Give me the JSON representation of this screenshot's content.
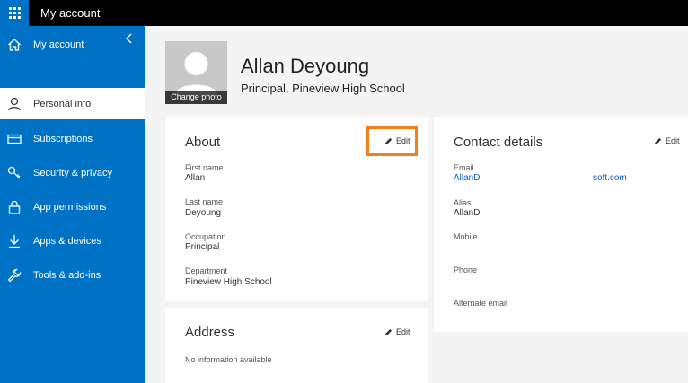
{
  "topbar": {
    "title": "My account"
  },
  "sidebar": {
    "items": [
      {
        "label": "My account",
        "icon": "home-icon",
        "active": false
      },
      {
        "label": "Personal info",
        "icon": "person-icon",
        "active": true
      },
      {
        "label": "Subscriptions",
        "icon": "card-icon",
        "active": false
      },
      {
        "label": "Security & privacy",
        "icon": "key-icon",
        "active": false
      },
      {
        "label": "App permissions",
        "icon": "lock-icon",
        "active": false
      },
      {
        "label": "Apps & devices",
        "icon": "download-icon",
        "active": false
      },
      {
        "label": "Tools & add-ins",
        "icon": "wrench-icon",
        "active": false
      }
    ]
  },
  "profile": {
    "name": "Allan Deyoung",
    "title": "Principal, Pineview High School",
    "change_photo": "Change photo"
  },
  "about": {
    "title": "About",
    "edit": "Edit",
    "fields": [
      {
        "label": "First name",
        "value": "Allan"
      },
      {
        "label": "Last name",
        "value": "Deyoung"
      },
      {
        "label": "Occupation",
        "value": "Principal"
      },
      {
        "label": "Department",
        "value": "Pineview High School"
      }
    ]
  },
  "address": {
    "title": "Address",
    "edit": "Edit",
    "empty": "No information available"
  },
  "contact": {
    "title": "Contact details",
    "edit": "Edit",
    "email_label": "Email",
    "email_value_start": "AllanD",
    "email_value_end": "soft.com",
    "alias_label": "Alias",
    "alias_value": "AllanD",
    "mobile_label": "Mobile",
    "phone_label": "Phone",
    "alternate_label": "Alternate email"
  },
  "colors": {
    "accent": "#0072c6",
    "highlight": "#f28022",
    "link": "#0060c0"
  }
}
